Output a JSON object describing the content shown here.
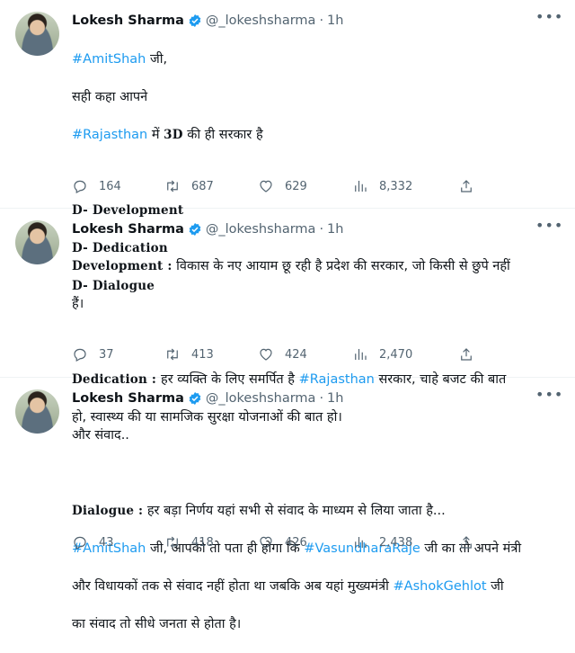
{
  "tweets": [
    {
      "name": "Lokesh Sharma",
      "handle": "@_lokeshsharma",
      "separator": "·",
      "time": "1h",
      "lines": {
        "l1_hash": "#AmitShah",
        "l1_text": " जी,",
        "l2": "सही कहा आपने",
        "l3_hash": "#Rajasthan",
        "l3_a": " में ",
        "l3_b": "3D",
        "l3_c": " की ही सरकार है",
        "l4": "D- Development",
        "l5": "D- Dedication",
        "l6": "D- Dialogue"
      },
      "stats": {
        "replies": "164",
        "retweets": "687",
        "likes": "629",
        "views": "8,332"
      }
    },
    {
      "name": "Lokesh Sharma",
      "handle": "@_lokeshsharma",
      "separator": "·",
      "time": "1h",
      "lines": {
        "p1_label": "Development :",
        "p1_text": " विकास के नए आयाम छू रही है प्रदेश की सरकार, जो किसी से छुपे नहीं",
        "p1_cont": "हैं।",
        "p2_label": "Dedication : ",
        "p2_text": " हर व्यक्ति के लिए समर्पित है ",
        "p2_hash": "#Rajasthan",
        "p2_text2": " सरकार, चाहे बजट की बात",
        "p2_cont": "हो, स्वास्थ्य की या सामजिक सुरक्षा योजनाओं की बात हो।"
      },
      "stats": {
        "replies": "37",
        "retweets": "413",
        "likes": "424",
        "views": "2,470"
      }
    },
    {
      "name": "Lokesh Sharma",
      "handle": "@_lokeshsharma",
      "separator": "·",
      "time": "1h",
      "lines": {
        "l1": "और संवाद..",
        "p_label": "Dialogue :",
        "p_text": " हर बड़ा निर्णय यहां सभी से संवाद के माध्यम से लिया जाता है...",
        "h1": "#AmitShah",
        "t1": " जी, आपको तो पता ही होगा कि ",
        "h2": "#VasundharaRaje",
        "t2": " जी का तो अपने मंत्री",
        "t3": "और विधायकों तक से संवाद नहीं होता था जबकि अब यहां मुख्यमंत्री ",
        "h3": "#AshokGehlot",
        "t4": " जी",
        "t5": "का संवाद तो सीधे जनता से होता है।"
      },
      "stats": {
        "replies": "43",
        "retweets": "418",
        "likes": "426",
        "views": "2,438"
      }
    }
  ],
  "icons": {
    "verified": "verified-badge-icon",
    "more": "more-icon",
    "reply": "reply-icon",
    "retweet": "retweet-icon",
    "like": "heart-icon",
    "views": "views-icon",
    "share": "share-icon"
  },
  "colors": {
    "link": "#1d9bf0",
    "muted": "#536471",
    "verified": "#1d9bf0"
  }
}
